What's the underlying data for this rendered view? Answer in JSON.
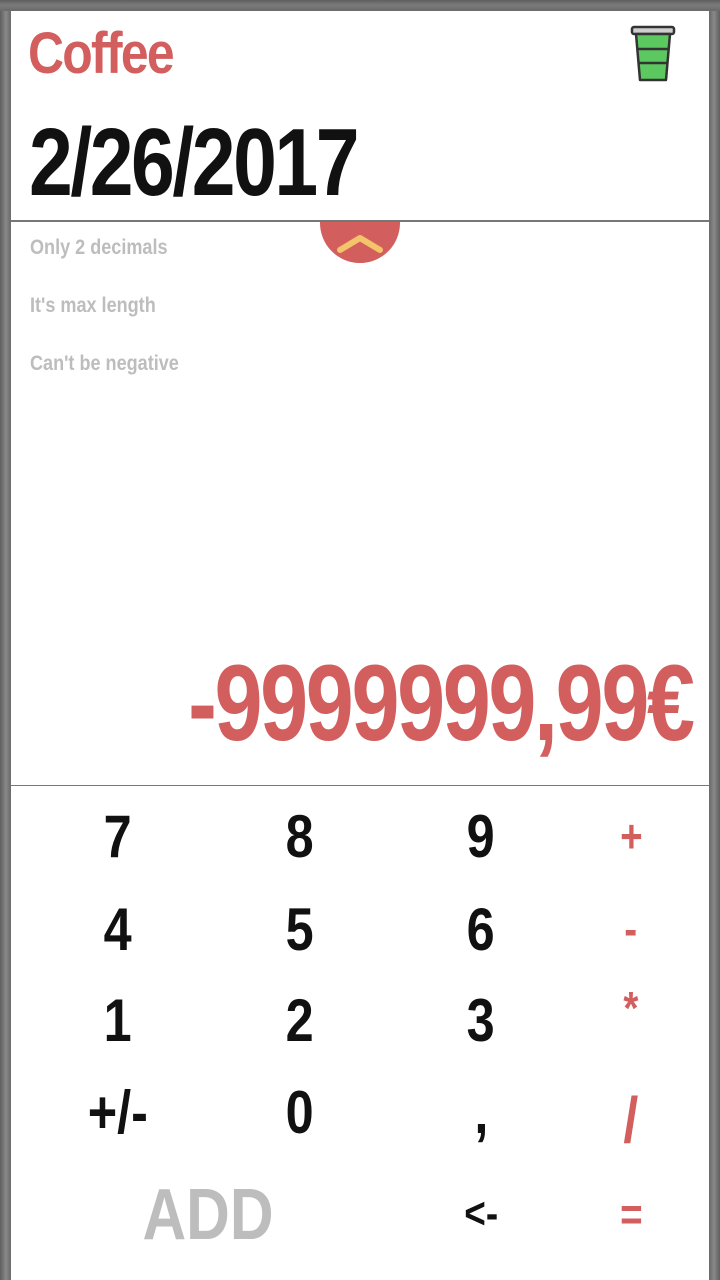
{
  "header": {
    "category": "Coffee",
    "date": "2/26/2017"
  },
  "icons": {
    "category_icon": "coffee-cup-icon",
    "toggle_icon": "chevron-up-icon"
  },
  "colors": {
    "accent": "#d35e5e",
    "cup_fill": "#5cc860",
    "chevron": "#f4c46a",
    "muted": "#bdbdbd"
  },
  "errors": [
    "Only 2 decimals",
    "It's max length",
    "Can't be negative"
  ],
  "amount": "-9999999,99€",
  "keypad": {
    "row1": [
      "7",
      "8",
      "9",
      "+"
    ],
    "row2": [
      "4",
      "5",
      "6",
      "-"
    ],
    "row3": [
      "1",
      "2",
      "3",
      "*"
    ],
    "row4": [
      "+/-",
      "0",
      ",",
      "/"
    ],
    "add": "ADD",
    "backspace": "<-",
    "equals": "="
  }
}
